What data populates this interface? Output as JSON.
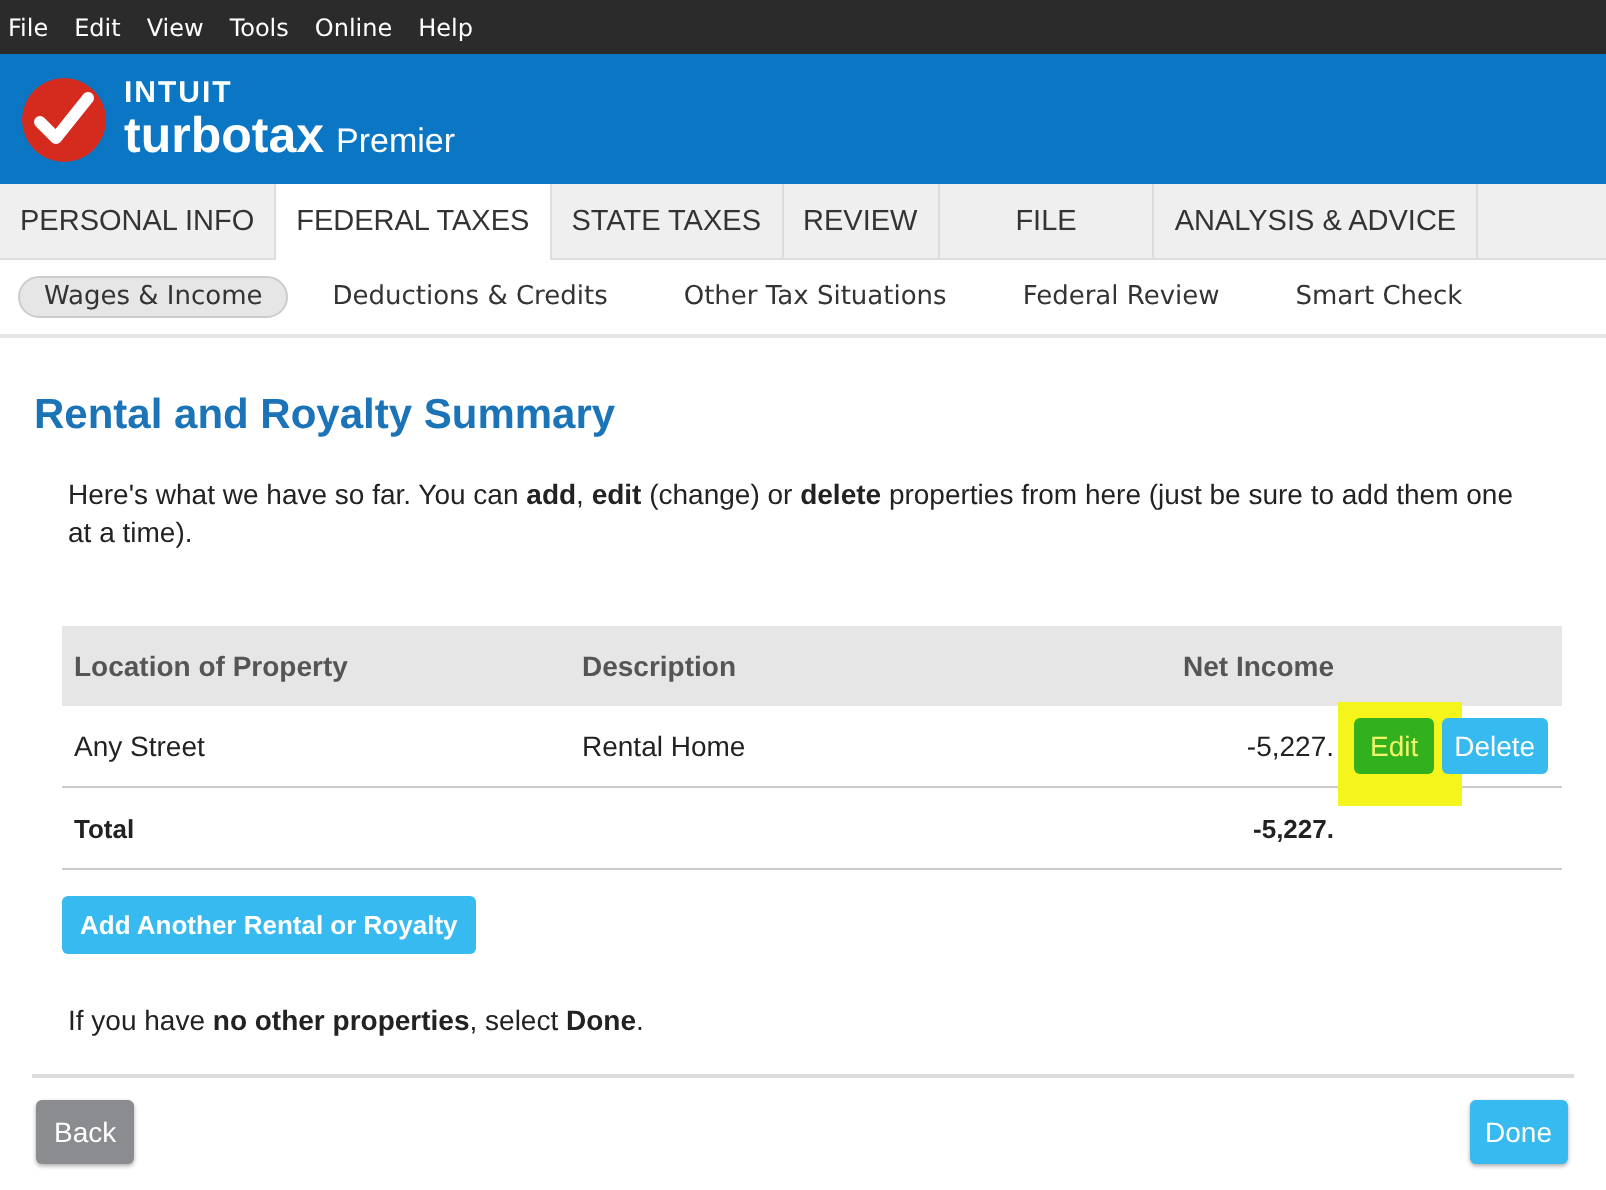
{
  "menu_bar": [
    "File",
    "Edit",
    "View",
    "Tools",
    "Online",
    "Help"
  ],
  "brand": {
    "company": "INTUIT",
    "product": "turbotax",
    "edition": "Premier"
  },
  "tabs": [
    {
      "label": "PERSONAL INFO",
      "selected": false
    },
    {
      "label": "FEDERAL TAXES",
      "selected": true
    },
    {
      "label": "STATE TAXES",
      "selected": false
    },
    {
      "label": "REVIEW",
      "selected": false
    },
    {
      "label": "FILE",
      "selected": false
    },
    {
      "label": "ANALYSIS & ADVICE",
      "selected": false
    }
  ],
  "subtabs": [
    {
      "label": "Wages & Income",
      "selected": true
    },
    {
      "label": "Deductions & Credits",
      "selected": false
    },
    {
      "label": "Other Tax Situations",
      "selected": false
    },
    {
      "label": "Federal Review",
      "selected": false
    },
    {
      "label": "Smart Check",
      "selected": false
    }
  ],
  "title": "Rental and Royalty Summary",
  "intro": "Here's what we have so far. You can **add**, **edit** (change) or **delete** properties from here (just be sure to add them one at a time).",
  "table": {
    "columns": [
      "Location of Property",
      "Description",
      "Net Income"
    ],
    "rows": [
      {
        "location": "Any Street",
        "description": "Rental Home",
        "net_income": "-5,227.",
        "actions": [
          {
            "label": "Edit",
            "highlighted": true
          },
          {
            "label": "Delete",
            "highlighted": false
          }
        ]
      }
    ],
    "total": {
      "label": "Total",
      "net_income": "-5,227."
    }
  },
  "add_button": "Add Another Rental or Royalty",
  "footer_text": "If you have **no other properties**, select **Done**.",
  "back_button": "Back",
  "done_button": "Done"
}
